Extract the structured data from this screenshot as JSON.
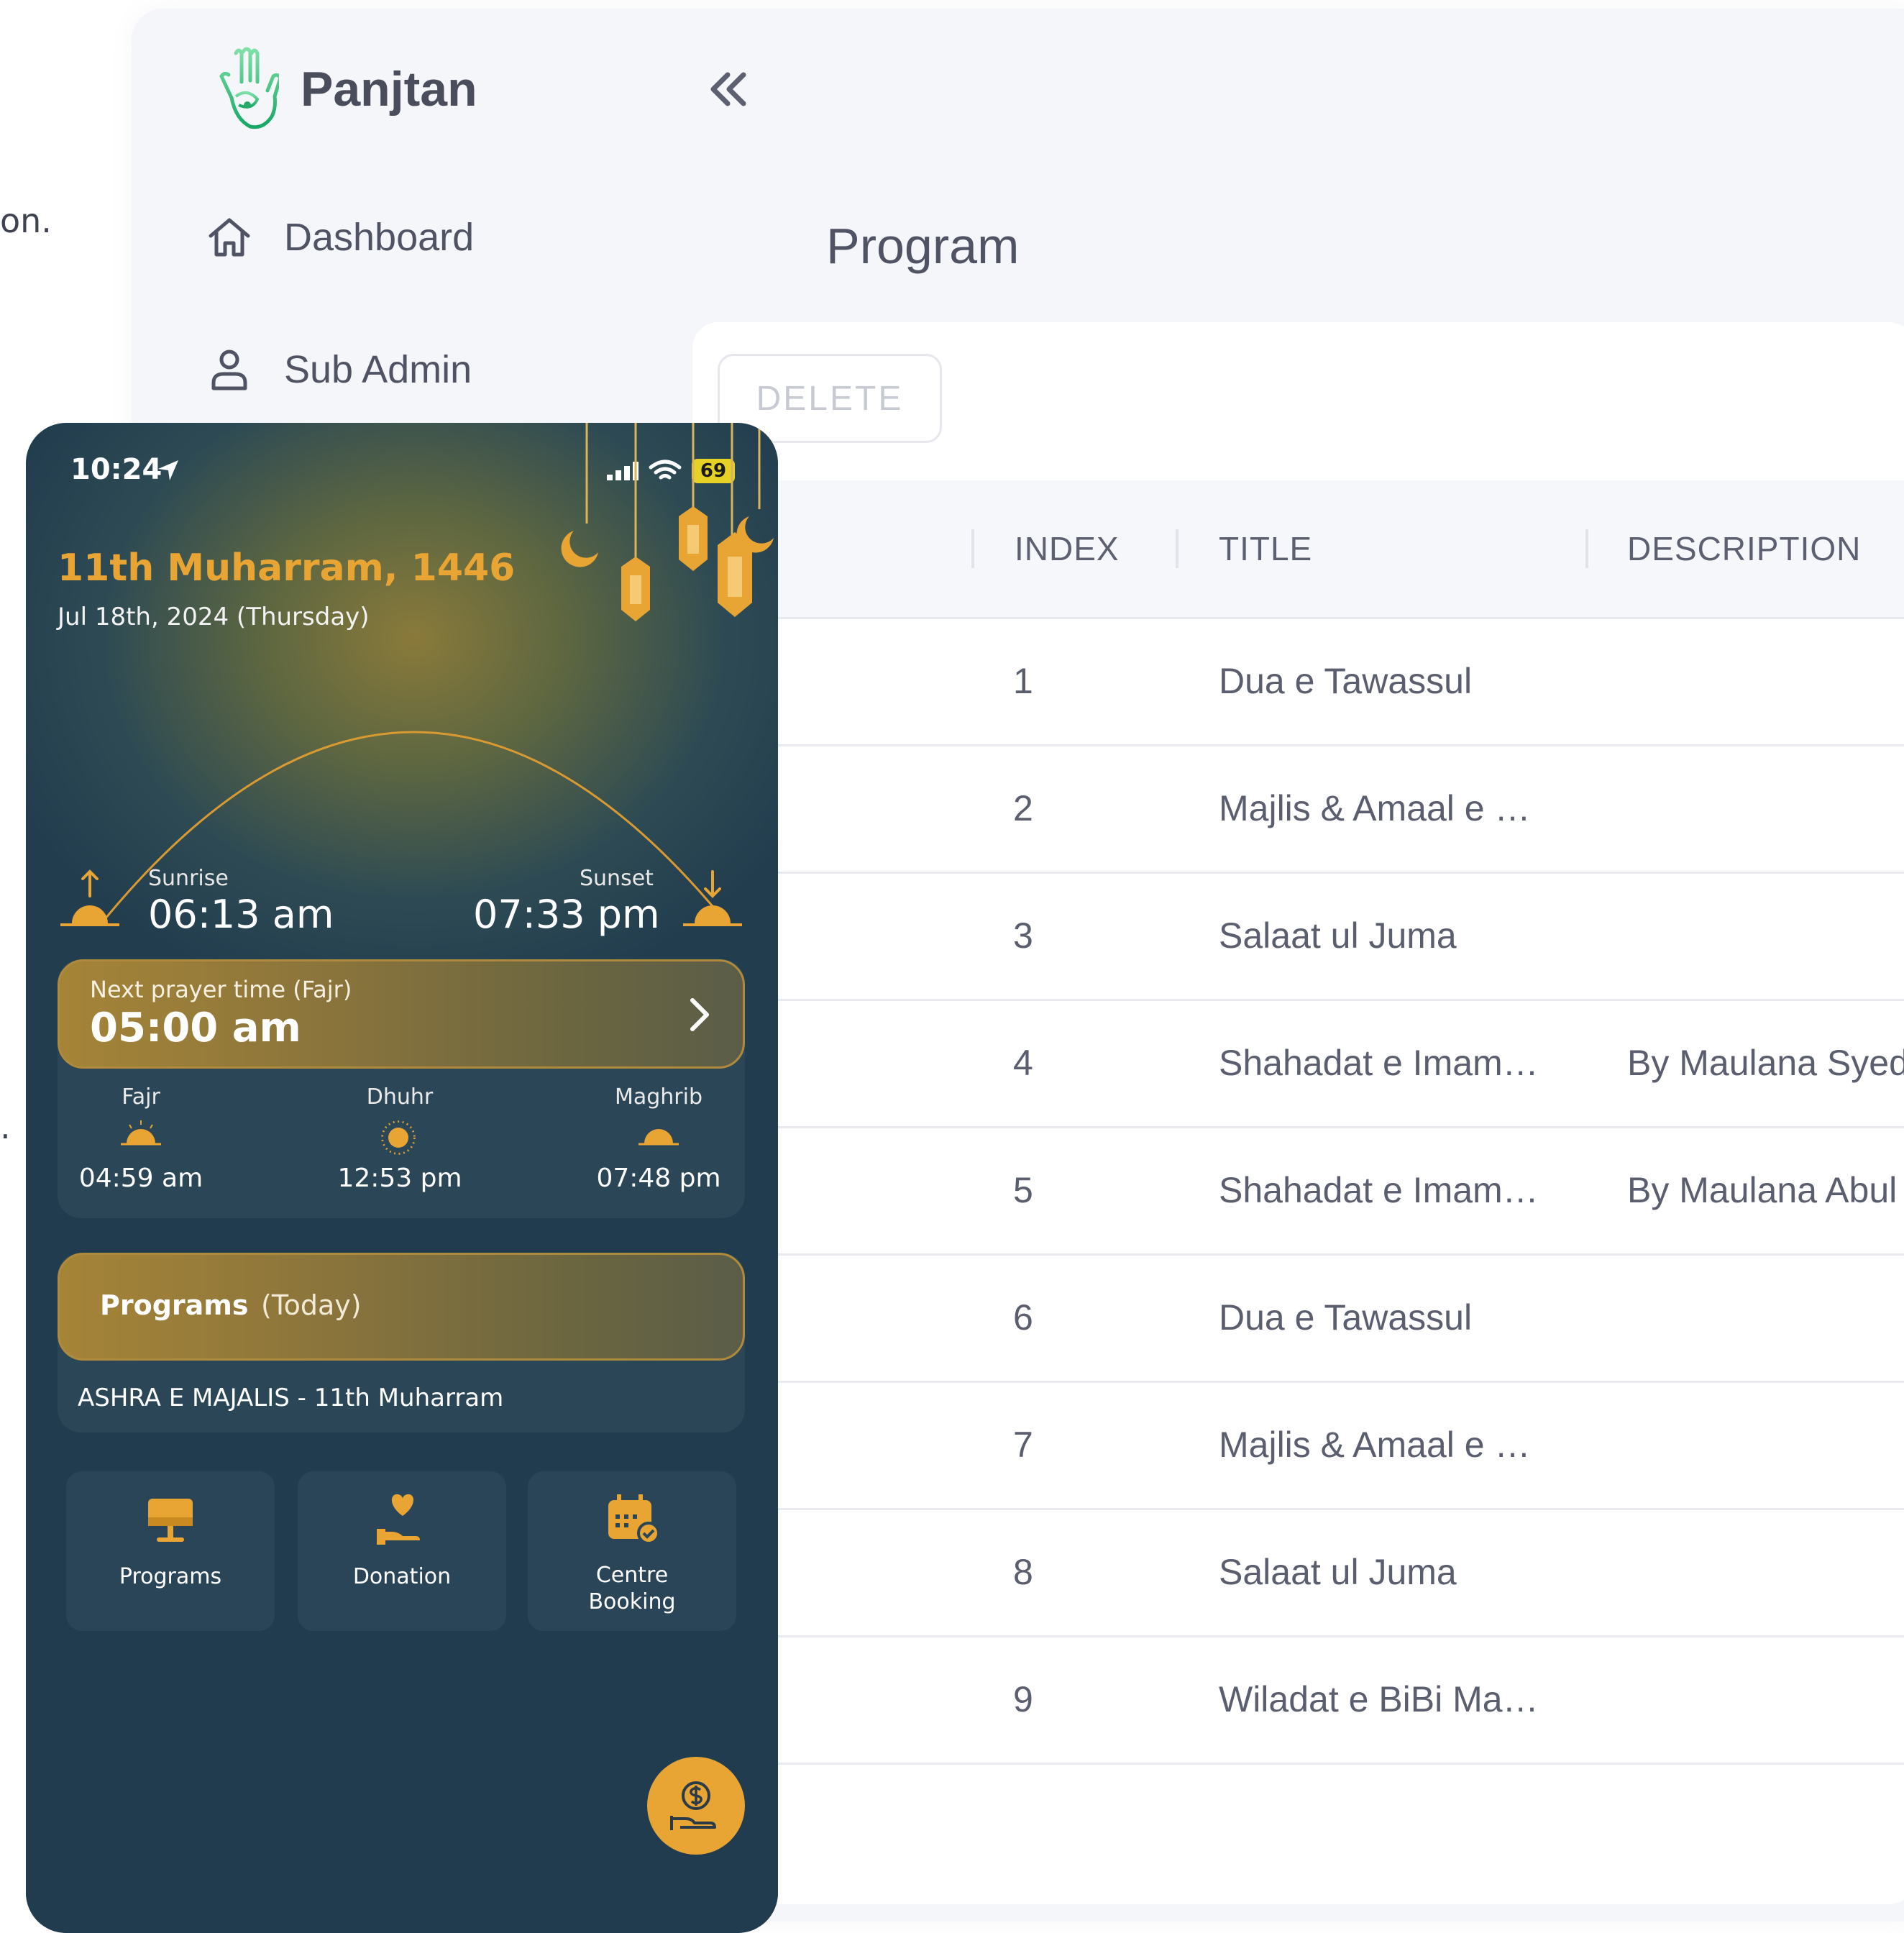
{
  "background_fragments": {
    "frag1": "on.",
    "frag2": "."
  },
  "admin": {
    "brand": "Panjtan",
    "nav": [
      {
        "label": "Dashboard",
        "icon": "home-icon"
      },
      {
        "label": "Sub Admin",
        "icon": "user-icon"
      }
    ],
    "page_title": "Program",
    "delete_label": "DELETE",
    "table": {
      "columns": [
        "INDEX",
        "TITLE",
        "DESCRIPTION"
      ],
      "rows": [
        {
          "index": "1",
          "title": "Dua e Tawassul",
          "description": ""
        },
        {
          "index": "2",
          "title": "Majlis & Amaal e …",
          "description": ""
        },
        {
          "index": "3",
          "title": "Salaat ul Juma",
          "description": ""
        },
        {
          "index": "4",
          "title": "Shahadat e Imam…",
          "description": "By Maulana Syed"
        },
        {
          "index": "5",
          "title": "Shahadat e Imam…",
          "description": "By Maulana Abul"
        },
        {
          "index": "6",
          "title": "Dua e Tawassul",
          "description": ""
        },
        {
          "index": "7",
          "title": "Majlis & Amaal e …",
          "description": ""
        },
        {
          "index": "8",
          "title": "Salaat ul Juma",
          "description": ""
        },
        {
          "index": "9",
          "title": "Wiladat e BiBi Ma…",
          "description": ""
        }
      ]
    }
  },
  "phone": {
    "status": {
      "time": "10:24",
      "battery": "69"
    },
    "hijri_date": "11th Muharram, 1446",
    "gregorian_date": "Jul 18th, 2024 (Thursday)",
    "sunrise": {
      "label": "Sunrise",
      "time": "06:13 am"
    },
    "sunset": {
      "label": "Sunset",
      "time": "07:33 pm"
    },
    "next_prayer": {
      "label": "Next prayer time (Fajr)",
      "time": "05:00 am"
    },
    "prayers": [
      {
        "name": "Fajr",
        "time": "04:59 am"
      },
      {
        "name": "Dhuhr",
        "time": "12:53 pm"
      },
      {
        "name": "Maghrib",
        "time": "07:48 pm"
      }
    ],
    "programs": {
      "label": "Programs",
      "sub": "(Today)",
      "item": "ASHRA E MAJALIS - 11th Muharram"
    },
    "tiles": [
      {
        "line1": "Programs",
        "line2": "",
        "icon": "podium-icon"
      },
      {
        "line1": "Donation",
        "line2": "",
        "icon": "donation-icon"
      },
      {
        "line1": "Centre",
        "line2": "Booking",
        "icon": "calendar-icon"
      }
    ],
    "fab_icon": "dollar-hand-icon",
    "colors": {
      "accent": "#e9a534",
      "panel": "#2b4656",
      "bg": "#223c4f"
    }
  }
}
